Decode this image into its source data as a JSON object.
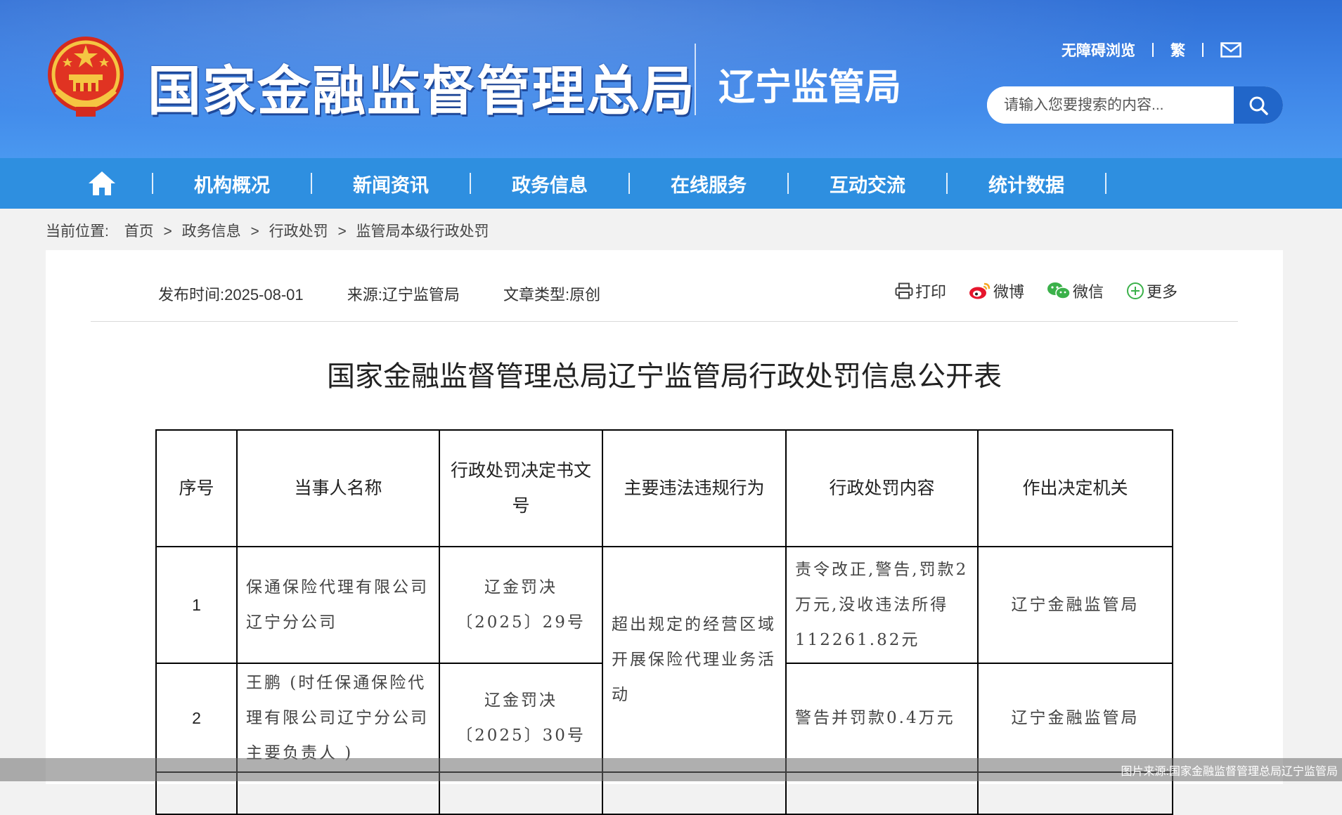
{
  "header": {
    "site_title": "国家金融监督管理总局",
    "sub_title": "辽宁监管局",
    "accessibility_link": "无障碍浏览",
    "traditional_link": "繁",
    "search_placeholder": "请输入您要搜索的内容..."
  },
  "nav": {
    "items": [
      "机构概况",
      "新闻资讯",
      "政务信息",
      "在线服务",
      "互动交流",
      "统计数据"
    ]
  },
  "breadcrumb": {
    "label": "当前位置:",
    "items": [
      "首页",
      "政务信息",
      "行政处罚",
      "监管局本级行政处罚"
    ],
    "separator": ">"
  },
  "article": {
    "publish_time": "发布时间:2025-08-01",
    "source": "来源:辽宁监管局",
    "type": "文章类型:原创",
    "share": {
      "print": "打印",
      "weibo": "微博",
      "wechat": "微信",
      "more": "更多"
    },
    "title": "国家金融监督管理总局辽宁监管局行政处罚信息公开表"
  },
  "table": {
    "headers": [
      "序号",
      "当事人名称",
      "行政处罚决定书文号",
      "主要违法违规行为",
      "行政处罚内容",
      "作出决定机关"
    ],
    "violation": "超出规定的经营区域开展保险代理业务活动",
    "rows": [
      {
        "no": "1",
        "party": "保通保险代理有限公司辽宁分公司",
        "doc_no": "辽金罚决〔2025〕29号",
        "penalty": "责令改正,警告,罚款2万元,没收违法所得112261.82元",
        "authority": "辽宁金融监管局"
      },
      {
        "no": "2",
        "party": "王鹏 (时任保通保险代理有限公司辽宁分公司主要负责人 )",
        "doc_no": "辽金罚决〔2025〕30号",
        "penalty": "警告并罚款0.4万元",
        "authority": "辽宁金融监管局"
      }
    ]
  },
  "watermark": "图片来源:国家金融监督管理总局辽宁监管局",
  "colors": {
    "header_blue": "#3a7fe0",
    "nav_blue": "#2e8fe0",
    "search_button": "#2166c9"
  }
}
